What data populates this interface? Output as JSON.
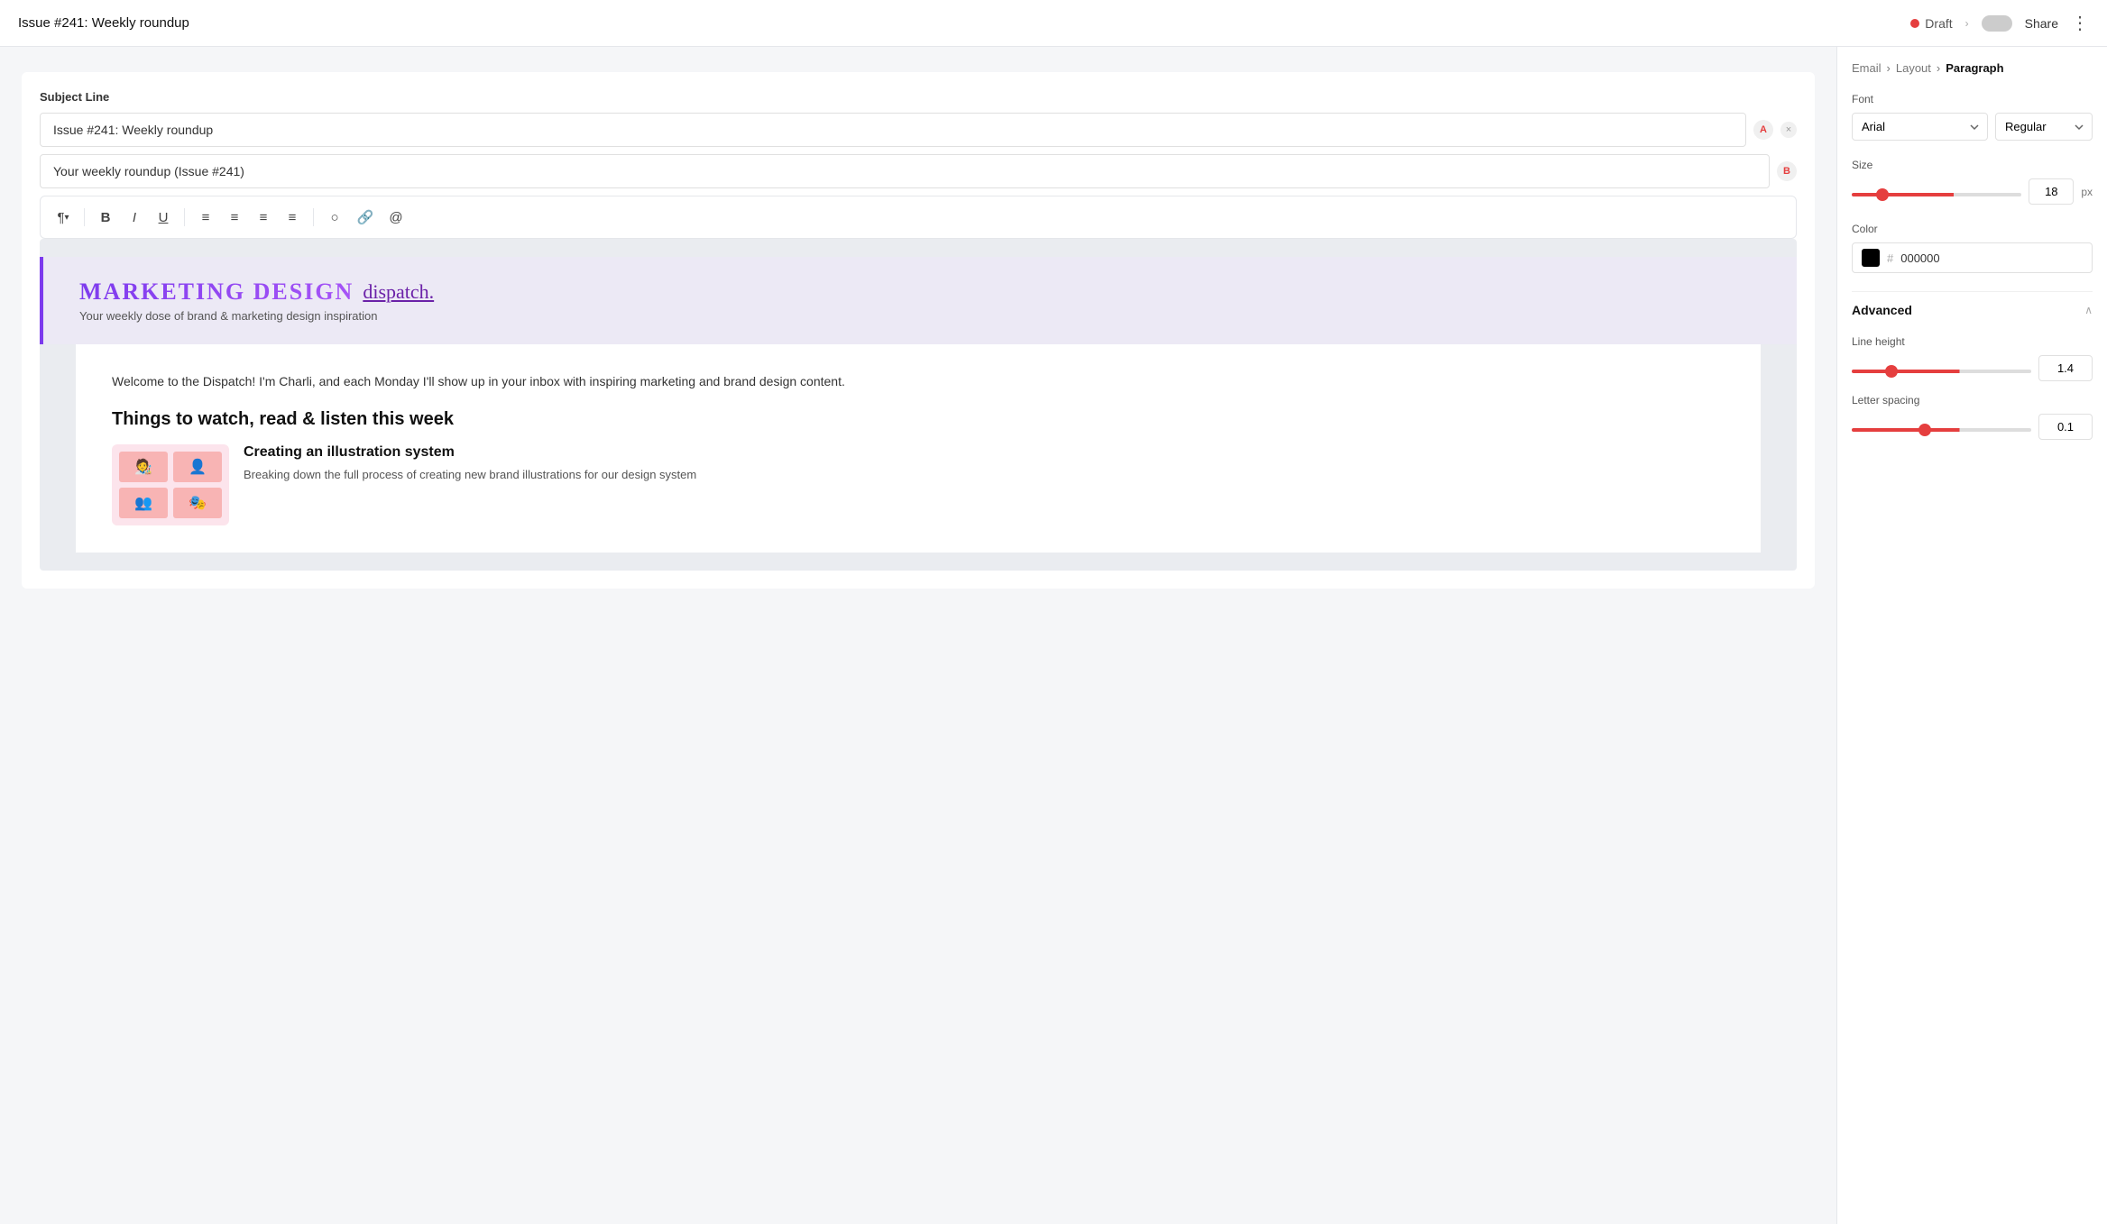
{
  "topbar": {
    "title": "Issue #241: Weekly roundup",
    "status": "Draft",
    "share_label": "Share"
  },
  "subject": {
    "label": "Subject Line",
    "value_a": "Issue #241: Weekly roundup",
    "value_b": "Your weekly roundup (Issue #241)",
    "a_badge": "A",
    "b_badge": "B"
  },
  "toolbar": {
    "paragraph_label": "¶"
  },
  "email_content": {
    "brand_name": "MARKETING DESIGN",
    "brand_script": "dispatch.",
    "tagline": "Your weekly dose of brand & marketing design inspiration",
    "intro": "Welcome to the Dispatch! I'm Charli, and each Monday I'll show up in your inbox with inspiring marketing and brand design content.",
    "section_title": "Things to watch, read & listen this week",
    "card_title": "Creating an illustration system",
    "card_desc": "Breaking down the full process of creating new brand illustrations for our design system"
  },
  "panel": {
    "breadcrumb": [
      "Email",
      "Layout",
      "Paragraph"
    ],
    "font_label": "Font",
    "font_value": "Arial",
    "style_value": "Regular",
    "size_label": "Size",
    "size_value": "18",
    "size_unit": "px",
    "color_label": "Color",
    "color_hex": "000000",
    "advanced_label": "Advanced",
    "line_height_label": "Line height",
    "line_height_value": "1.4",
    "letter_spacing_label": "Letter spacing",
    "letter_spacing_value": "0.1"
  }
}
